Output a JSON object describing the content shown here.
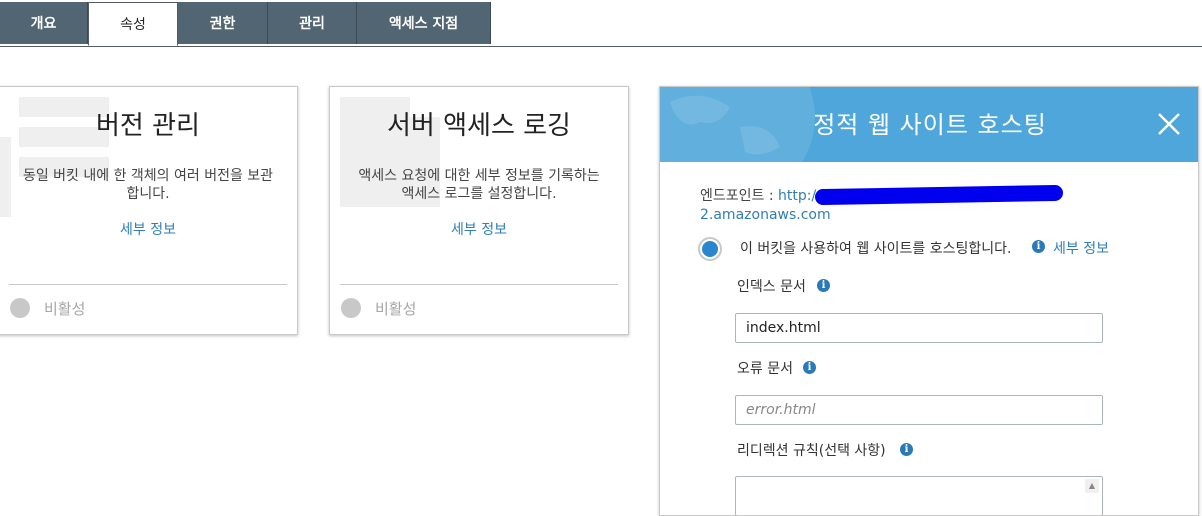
{
  "tabs": [
    {
      "label": "개요",
      "active": false
    },
    {
      "label": "속성",
      "active": true
    },
    {
      "label": "권한",
      "active": false
    },
    {
      "label": "관리",
      "active": false
    },
    {
      "label": "액세스 지점",
      "active": false
    }
  ],
  "cards": [
    {
      "title": "버전 관리",
      "description": "동일 버킷 내에 한 객체의 여러 버전을 보관합니다.",
      "more_link": "세부 정보",
      "status_label": "비활성"
    },
    {
      "title": "서버 액세스 로깅",
      "description": "액세스 요청에 대한 세부 정보를 기록하는 액세스 로그를 설정합니다.",
      "more_link": "세부 정보",
      "status_label": "비활성"
    }
  ],
  "hosting_panel": {
    "title": "정적 웹 사이트 호스팅",
    "endpoint_label": "엔드포인트 : ",
    "endpoint_link_start": "http://",
    "endpoint_link_end": "2.amazonaws.com",
    "host_option_label": "이 버킷을 사용하여 웹 사이트를 호스팅합니다.",
    "host_more_link": "세부 정보",
    "index_label": "인덱스 문서",
    "index_value": "index.html",
    "error_label": "오류 문서",
    "error_placeholder": "error.html",
    "redirect_label": "리디렉션 규칙(선택 사항)"
  },
  "colors": {
    "tab_bg": "#516572",
    "panel_header": "#4ea6da",
    "link": "#2f7fb5",
    "radio_selected": "#2a87cf"
  },
  "icons": {
    "close": "close-icon",
    "info": "info-icon"
  }
}
